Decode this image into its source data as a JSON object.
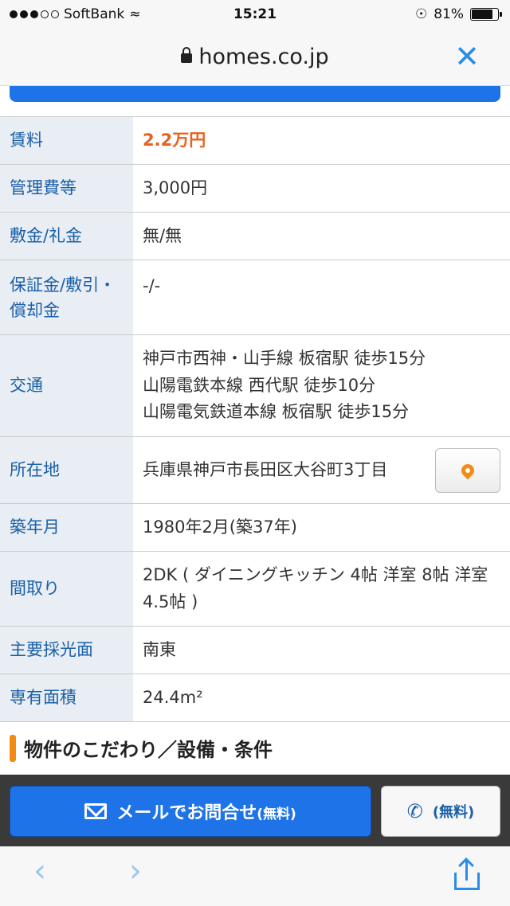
{
  "status_bar": {
    "carrier": "SoftBank",
    "time": "15:21",
    "battery_percent": "81%",
    "battery_level": 0.81
  },
  "browser": {
    "domain": "homes.co.jp"
  },
  "details": [
    {
      "label": "賃料",
      "value": "2.2万円"
    },
    {
      "label": "管理費等",
      "value": "3,000円"
    },
    {
      "label": "敷金/礼金",
      "value": "無/無"
    },
    {
      "label": "保証金/敷引・償却金",
      "value": "-/-"
    },
    {
      "label": "交通",
      "lines": [
        "神戸市西神・山手線 板宿駅 徒歩15分",
        "山陽電鉄本線 西代駅 徒歩10分",
        "山陽電気鉄道本線 板宿駅 徒歩15分"
      ]
    },
    {
      "label": "所在地",
      "value": "兵庫県神戸市長田区大谷町3丁目"
    },
    {
      "label": "築年月",
      "value": "1980年2月(築37年)"
    },
    {
      "label": "間取り",
      "value": "2DK ( ダイニングキッチン 4帖 洋室 8帖 洋室 4.5帖 )"
    },
    {
      "label": "主要採光面",
      "value": "南東"
    },
    {
      "label": "専有面積",
      "value": "24.4m²"
    }
  ],
  "section_heading": "物件のこだわり／設備・条件",
  "cta": {
    "mail_label": "メールでお問合せ",
    "mail_free": "(無料)",
    "tel_free": "(無料)"
  },
  "colors": {
    "accent_blue": "#1e73e8",
    "price_orange": "#e8601d",
    "label_bg": "#e8eef3"
  }
}
